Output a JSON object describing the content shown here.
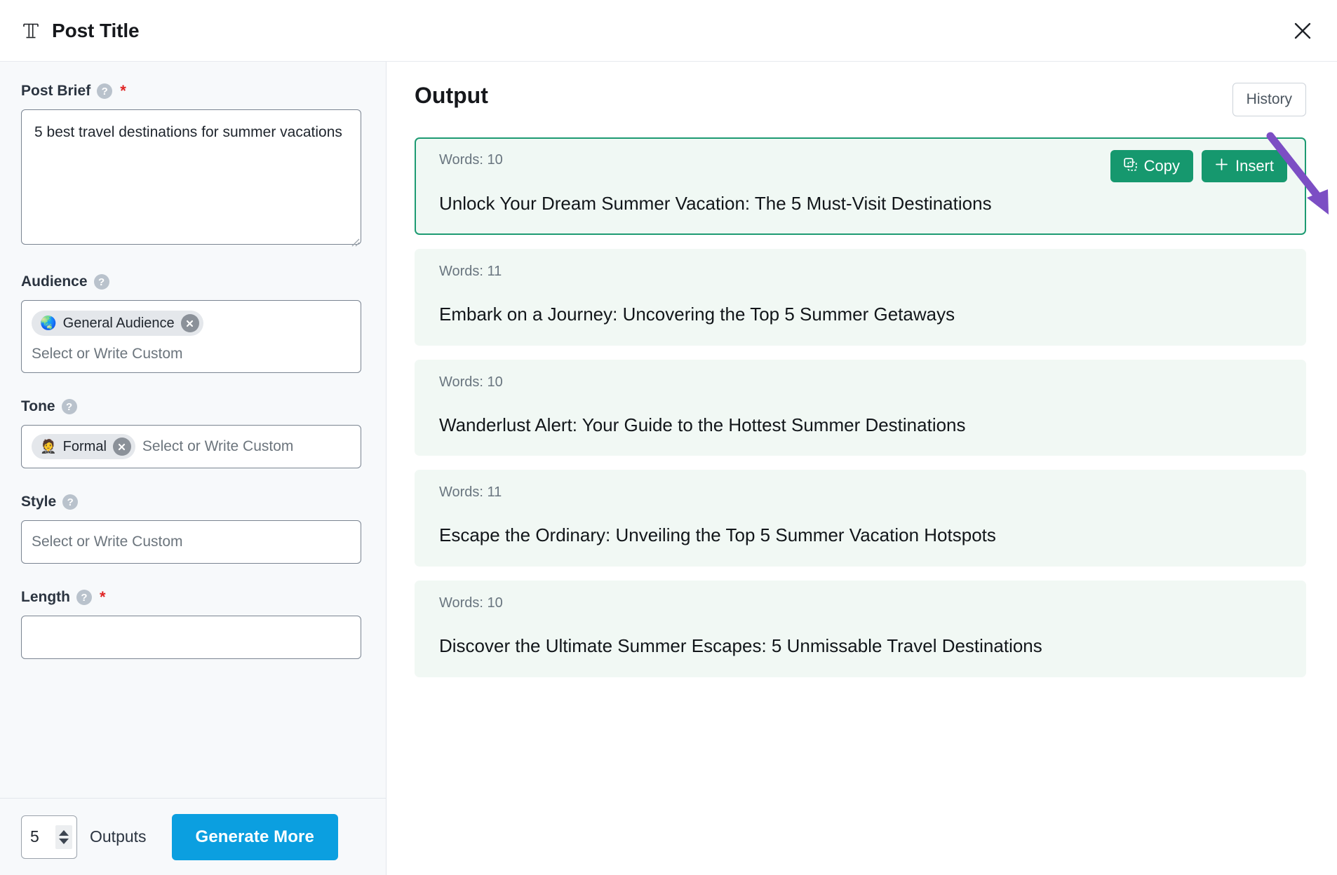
{
  "header": {
    "icon": "text-tool-icon",
    "icon_glyph": "ᵔB",
    "title": "Post Title",
    "close_icon": "close-icon"
  },
  "form": {
    "post_brief": {
      "label": "Post Brief",
      "required_mark": "*",
      "help_icon": "?",
      "value": "5 best travel destinations for summer vacations"
    },
    "audience": {
      "label": "Audience",
      "help_icon": "?",
      "chip": {
        "emoji": "🌏",
        "label": "General Audience",
        "remove_icon": "close-icon"
      },
      "placeholder": "Select or Write Custom"
    },
    "tone": {
      "label": "Tone",
      "help_icon": "?",
      "chip": {
        "emoji": "🤵",
        "label": "Formal",
        "remove_icon": "close-icon"
      },
      "placeholder": "Select or Write Custom"
    },
    "style": {
      "label": "Style",
      "help_icon": "?",
      "placeholder": "Select or Write Custom"
    },
    "length": {
      "label": "Length",
      "required_mark": "*",
      "help_icon": "?"
    }
  },
  "bottom_bar": {
    "outputs_value": "5",
    "outputs_label": "Outputs",
    "generate_label": "Generate More",
    "generate_color": "#0b9fe0",
    "spinner_up_icon": "chevron-up-icon",
    "spinner_down_icon": "chevron-down-icon"
  },
  "output": {
    "title": "Output",
    "history_label": "History",
    "copy_label": "Copy",
    "insert_label": "Insert",
    "copy_icon": "copy-icon",
    "insert_icon": "plus-icon",
    "accent_color": "#16986e",
    "selected_border_color": "#1d9b72",
    "annotation_arrow_color": "#7c4ec4",
    "cards": [
      {
        "words_label": "Words: 10",
        "text": "Unlock Your Dream Summer Vacation: The 5 Must-Visit Destinations",
        "selected": true
      },
      {
        "words_label": "Words: 11",
        "text": "Embark on a Journey: Uncovering the Top 5 Summer Getaways",
        "selected": false
      },
      {
        "words_label": "Words: 10",
        "text": "Wanderlust Alert: Your Guide to the Hottest Summer Destinations",
        "selected": false
      },
      {
        "words_label": "Words: 11",
        "text": "Escape the Ordinary: Unveiling the Top 5 Summer Vacation Hotspots",
        "selected": false
      },
      {
        "words_label": "Words: 10",
        "text": "Discover the Ultimate Summer Escapes: 5 Unmissable Travel Destinations",
        "selected": false
      }
    ]
  }
}
